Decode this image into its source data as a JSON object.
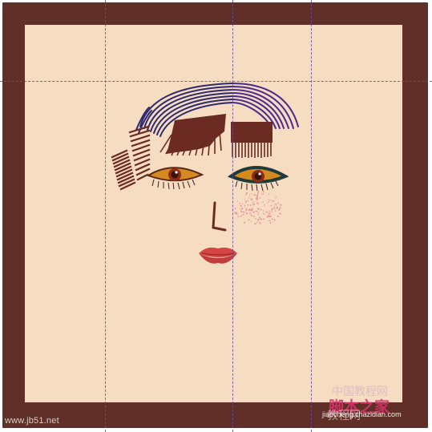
{
  "footer": {
    "credit": "www.jb51.net"
  },
  "watermark": {
    "faint_top": "中国教程网",
    "main": "脚本之家",
    "faint_bottom": "教程网",
    "url": "jiaocheng.chazidian.com"
  },
  "colors": {
    "frame": "#603028",
    "canvas": "#f6dcc0",
    "hair_blue": "#2c2a6e",
    "hair_purple": "#4a2a8c",
    "brown": "#6b2a22",
    "iris": "#d58a20",
    "lips": "#cf4a4a",
    "freckles": "#e6909a",
    "guide": "#6a4a9c"
  }
}
